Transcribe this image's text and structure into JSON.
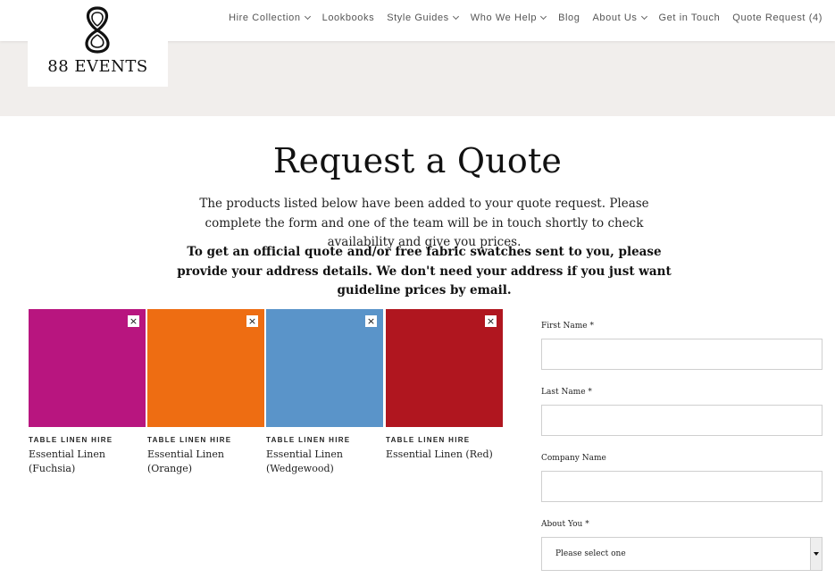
{
  "brand": {
    "name": "88 EVENTS"
  },
  "nav": [
    {
      "label": "Hire Collection",
      "dropdown": true
    },
    {
      "label": "Lookbooks",
      "dropdown": false
    },
    {
      "label": "Style Guides",
      "dropdown": true
    },
    {
      "label": "Who We Help",
      "dropdown": true
    },
    {
      "label": "Blog",
      "dropdown": false
    },
    {
      "label": "About Us",
      "dropdown": true
    },
    {
      "label": "Get in Touch",
      "dropdown": false
    },
    {
      "label": "Quote Request (4)",
      "dropdown": false
    }
  ],
  "page": {
    "title": "Request a Quote",
    "intro": "The products listed below have been added to your quote request. Please complete the form and one of the team will be in touch shortly to check availability and give you prices.",
    "intro_bold": "To get an official quote and/or free fabric swatches sent to you, please provide your address details. We don't need your address if you just want guideline prices by email."
  },
  "products": [
    {
      "category": "TABLE LINEN HIRE",
      "name": "Essential Linen (Fuchsia)",
      "color": "#b8157f",
      "remove": "×"
    },
    {
      "category": "TABLE LINEN HIRE",
      "name": "Essential Linen (Orange)",
      "color": "#ee6d12",
      "remove": "×"
    },
    {
      "category": "TABLE LINEN HIRE",
      "name": "Essential Linen (Wedgewood)",
      "color": "#5a94c9",
      "remove": "×"
    },
    {
      "category": "TABLE LINEN HIRE",
      "name": "Essential Linen (Red)",
      "color": "#b0161f",
      "remove": "×"
    }
  ],
  "form": {
    "first_name_label": "First Name *",
    "last_name_label": "Last Name *",
    "company_label": "Company Name",
    "about_label": "About You *",
    "about_value": "Please select one"
  },
  "colors": {
    "header_band": "#f1eeec",
    "nav_text": "#555555"
  }
}
